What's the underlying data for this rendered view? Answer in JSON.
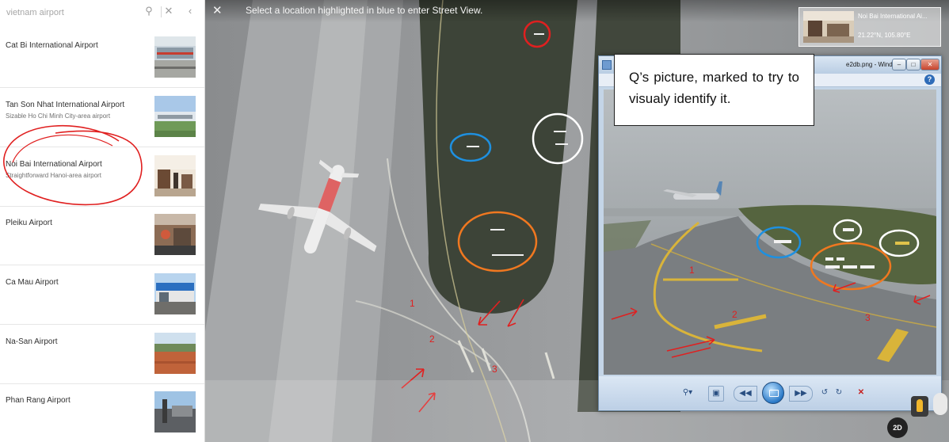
{
  "search": {
    "placeholder": "vietnam airport"
  },
  "results": [
    {
      "name": "Cat Bi International Airport",
      "desc": ""
    },
    {
      "name": "Tan Son Nhat International Airport",
      "desc": "Sizable Ho Chi Minh City-area airport"
    },
    {
      "name": "Noi Bai International Airport",
      "desc": "Straightforward Hanoi-area airport"
    },
    {
      "name": "Pleiku Airport",
      "desc": ""
    },
    {
      "name": "Ca Mau Airport",
      "desc": ""
    },
    {
      "name": "Na-San Airport",
      "desc": ""
    },
    {
      "name": "Phan Rang Airport",
      "desc": ""
    }
  ],
  "streetview": {
    "instruction": "Select a location highlighted in blue to enter Street View."
  },
  "location_card": {
    "title": "Noi Bai International Ai...",
    "coords": "21.22°N, 105.80°E"
  },
  "viewer": {
    "title": "e2db.png - Windows ...",
    "help": "?"
  },
  "callout": {
    "text": "Q’s picture, marked to try to visualy identify it."
  },
  "annotations": {
    "left_numbers": [
      "1",
      "2",
      "3"
    ],
    "right_numbers": [
      "1",
      "2",
      "3"
    ]
  },
  "controls": {
    "mode_label": "2D"
  },
  "colors": {
    "red": "#e02020",
    "blue": "#1e90e0",
    "orange": "#f07820",
    "white": "#ffffff",
    "marking_yellow": "#e0b030",
    "grass": "#3d4438",
    "tarmac": "#8c8f91"
  },
  "icons": {
    "search": "search-icon",
    "clear": "close-icon",
    "collapse": "chevron-left-icon",
    "close_streetview": "close-icon"
  }
}
